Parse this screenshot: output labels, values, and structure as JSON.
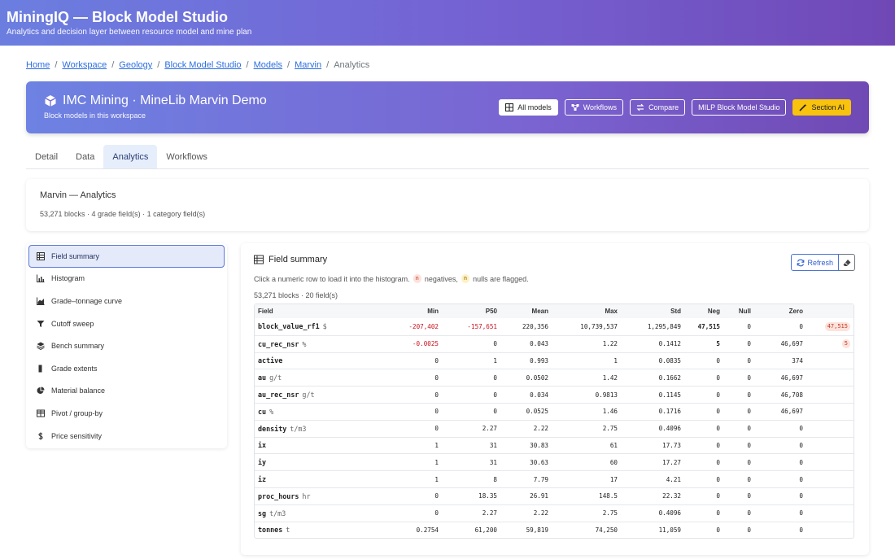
{
  "app": {
    "title": "MiningIQ — Block Model Studio",
    "subtitle": "Analytics and decision layer between resource model and mine plan"
  },
  "breadcrumb": [
    {
      "label": "Home"
    },
    {
      "label": "Workspace"
    },
    {
      "label": "Geology"
    },
    {
      "label": "Block Model Studio"
    },
    {
      "label": "Models"
    },
    {
      "label": "Marvin"
    },
    {
      "label": "Analytics"
    }
  ],
  "hero": {
    "title": "IMC Mining · MineLib Marvin Demo",
    "subtitle": "Block models in this workspace",
    "buttons": {
      "all_models": "All models",
      "workflows": "Workflows",
      "compare": "Compare",
      "milp": "MILP Block Model Studio",
      "section_ai": "Section AI"
    }
  },
  "tabs": {
    "detail": "Detail",
    "data": "Data",
    "analytics": "Analytics",
    "workflows": "Workflows"
  },
  "info": {
    "title": "Marvin — Analytics",
    "summary": "53,271 blocks · 4 grade field(s) · 1 category field(s)"
  },
  "sidebar": {
    "items": [
      {
        "label": "Field summary",
        "icon": "table-icon"
      },
      {
        "label": "Histogram",
        "icon": "bar-chart-icon"
      },
      {
        "label": "Grade–tonnage curve",
        "icon": "area-chart-icon"
      },
      {
        "label": "Cutoff sweep",
        "icon": "filter-icon"
      },
      {
        "label": "Bench summary",
        "icon": "layers-icon"
      },
      {
        "label": "Grade extents",
        "icon": "bar-icon"
      },
      {
        "label": "Material balance",
        "icon": "pie-chart-icon"
      },
      {
        "label": "Pivot / group-by",
        "icon": "grid-icon"
      },
      {
        "label": "Price sensitivity",
        "icon": "dollar-icon"
      }
    ]
  },
  "panel": {
    "title": "Field summary",
    "refresh": "Refresh",
    "hint_pre": "Click a numeric row to load it into the histogram.",
    "chip_n": "n",
    "hint_neg": "negatives,",
    "hint_null": "nulls are flagged.",
    "count": "53,271 blocks · 20 field(s)",
    "columns": {
      "field": "Field",
      "min": "Min",
      "p50": "P50",
      "mean": "Mean",
      "max": "Max",
      "std": "Std",
      "neg": "Neg",
      "null": "Null",
      "zero": "Zero"
    },
    "rows": [
      {
        "name": "block_value_rf1",
        "unit": "$",
        "min": "-207,402",
        "p50": "-157,651",
        "mean": "220,356",
        "max": "10,739,537",
        "std": "1,295,849",
        "neg": "47,515",
        "null": "0",
        "zero": "0",
        "flag": "47,515"
      },
      {
        "name": "cu_rec_nsr",
        "unit": "%",
        "min": "-0.0025",
        "p50": "0",
        "mean": "0.043",
        "max": "1.22",
        "std": "0.1412",
        "neg": "5",
        "null": "0",
        "zero": "46,697",
        "flag": "5"
      },
      {
        "name": "active",
        "unit": "",
        "min": "0",
        "p50": "1",
        "mean": "0.993",
        "max": "1",
        "std": "0.0835",
        "neg": "0",
        "null": "0",
        "zero": "374",
        "flag": ""
      },
      {
        "name": "au",
        "unit": "g/t",
        "min": "0",
        "p50": "0",
        "mean": "0.0502",
        "max": "1.42",
        "std": "0.1662",
        "neg": "0",
        "null": "0",
        "zero": "46,697",
        "flag": ""
      },
      {
        "name": "au_rec_nsr",
        "unit": "g/t",
        "min": "0",
        "p50": "0",
        "mean": "0.034",
        "max": "0.9813",
        "std": "0.1145",
        "neg": "0",
        "null": "0",
        "zero": "46,708",
        "flag": ""
      },
      {
        "name": "cu",
        "unit": "%",
        "min": "0",
        "p50": "0",
        "mean": "0.0525",
        "max": "1.46",
        "std": "0.1716",
        "neg": "0",
        "null": "0",
        "zero": "46,697",
        "flag": ""
      },
      {
        "name": "density",
        "unit": "t/m3",
        "min": "0",
        "p50": "2.27",
        "mean": "2.22",
        "max": "2.75",
        "std": "0.4096",
        "neg": "0",
        "null": "0",
        "zero": "0",
        "flag": ""
      },
      {
        "name": "ix",
        "unit": "",
        "min": "1",
        "p50": "31",
        "mean": "30.83",
        "max": "61",
        "std": "17.73",
        "neg": "0",
        "null": "0",
        "zero": "0",
        "flag": ""
      },
      {
        "name": "iy",
        "unit": "",
        "min": "1",
        "p50": "31",
        "mean": "30.63",
        "max": "60",
        "std": "17.27",
        "neg": "0",
        "null": "0",
        "zero": "0",
        "flag": ""
      },
      {
        "name": "iz",
        "unit": "",
        "min": "1",
        "p50": "8",
        "mean": "7.79",
        "max": "17",
        "std": "4.21",
        "neg": "0",
        "null": "0",
        "zero": "0",
        "flag": ""
      },
      {
        "name": "proc_hours",
        "unit": "hr",
        "min": "0",
        "p50": "18.35",
        "mean": "26.91",
        "max": "148.5",
        "std": "22.32",
        "neg": "0",
        "null": "0",
        "zero": "0",
        "flag": ""
      },
      {
        "name": "sg",
        "unit": "t/m3",
        "min": "0",
        "p50": "2.27",
        "mean": "2.22",
        "max": "2.75",
        "std": "0.4096",
        "neg": "0",
        "null": "0",
        "zero": "0",
        "flag": ""
      },
      {
        "name": "tonnes",
        "unit": "t",
        "min": "0.2754",
        "p50": "61,200",
        "mean": "59,819",
        "max": "74,250",
        "std": "11,059",
        "neg": "0",
        "null": "0",
        "zero": "0",
        "flag": ""
      }
    ]
  },
  "colors": {
    "accent": "#6b7ee0",
    "brand_end": "#7048b6",
    "negative": "#c8101e",
    "section_ai": "#f8c20d"
  }
}
